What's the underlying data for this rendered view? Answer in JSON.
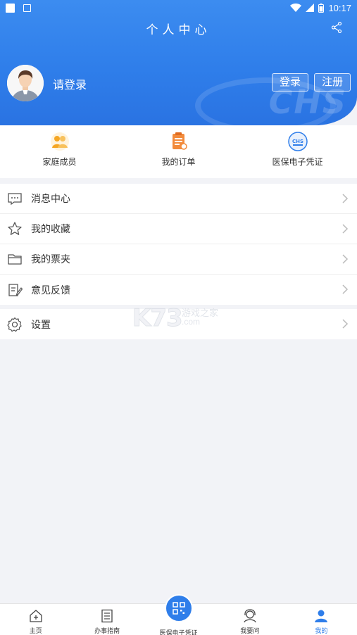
{
  "status": {
    "time": "10:17"
  },
  "header": {
    "title": "个人中心",
    "login_prompt": "请登录",
    "login_button": "登录",
    "register_button": "注册"
  },
  "quick_actions": [
    {
      "label": "家庭成员",
      "icon": "family-icon"
    },
    {
      "label": "我的订单",
      "icon": "order-icon"
    },
    {
      "label": "医保电子凭证",
      "icon": "chs-icon"
    }
  ],
  "menu": [
    {
      "label": "消息中心",
      "icon": "message-icon"
    },
    {
      "label": "我的收藏",
      "icon": "star-icon"
    },
    {
      "label": "我的票夹",
      "icon": "folder-icon"
    },
    {
      "label": "意见反馈",
      "icon": "feedback-icon"
    }
  ],
  "settings": {
    "label": "设置",
    "icon": "gear-icon"
  },
  "watermark": {
    "brand": "K73",
    "line1": "游戏之家",
    "line2": ".com"
  },
  "tabbar": [
    {
      "label": "主页",
      "icon": "home-icon"
    },
    {
      "label": "办事指南",
      "icon": "guide-icon"
    },
    {
      "label": "医保电子凭证",
      "icon": "qr-icon"
    },
    {
      "label": "我要问",
      "icon": "support-icon"
    },
    {
      "label": "我的",
      "icon": "user-icon"
    }
  ],
  "colors": {
    "primary": "#2f7eea",
    "accent_orange": "#f5a623",
    "background": "#f2f3f7"
  }
}
